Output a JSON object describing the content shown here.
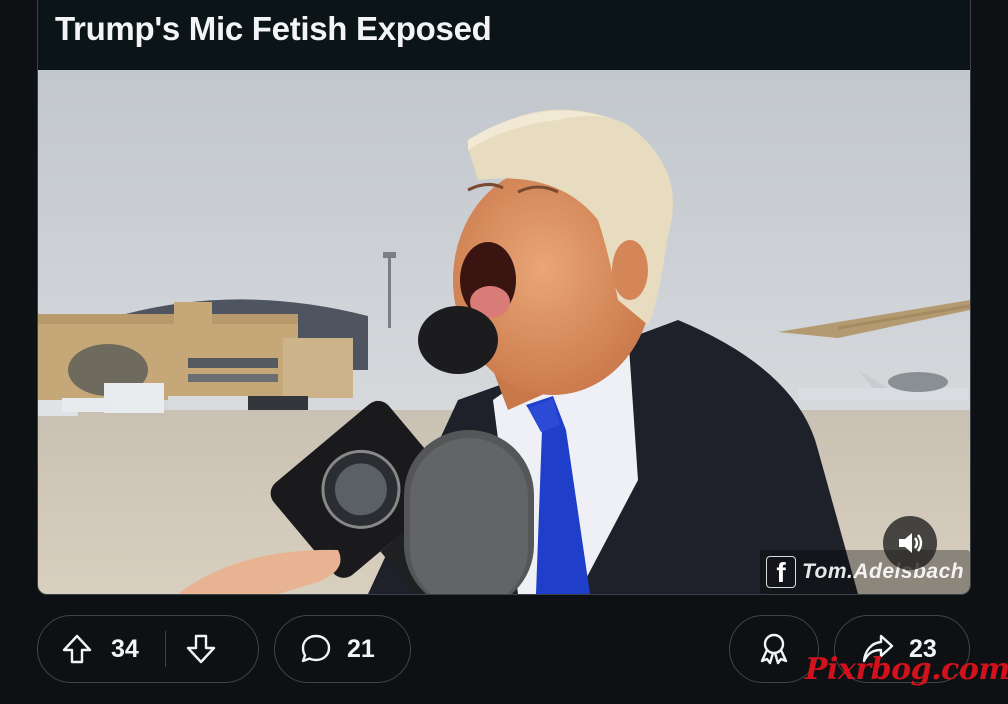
{
  "post": {
    "title": "Trump's Mic Fetish Exposed",
    "media": {
      "type": "video",
      "watermark_logo": "f",
      "watermark_author": "Tom.Adelsbach",
      "sound_icon": "speaker-volume-icon"
    }
  },
  "actions": {
    "upvote_icon": "arrow-up-icon",
    "downvote_icon": "arrow-down-icon",
    "vote_count": "34",
    "comment_icon": "speech-bubble-icon",
    "comment_count": "21",
    "award_icon": "award-ribbon-icon",
    "share_icon": "share-arrow-icon",
    "share_count": "23"
  },
  "overlay": {
    "site_watermark": "Pixrbog.com"
  },
  "colors": {
    "background": "#0e1113",
    "border": "#3e4549",
    "text": "#f2f4f5",
    "tie": "#1f3ec9",
    "site_watermark": "#e0121c"
  }
}
